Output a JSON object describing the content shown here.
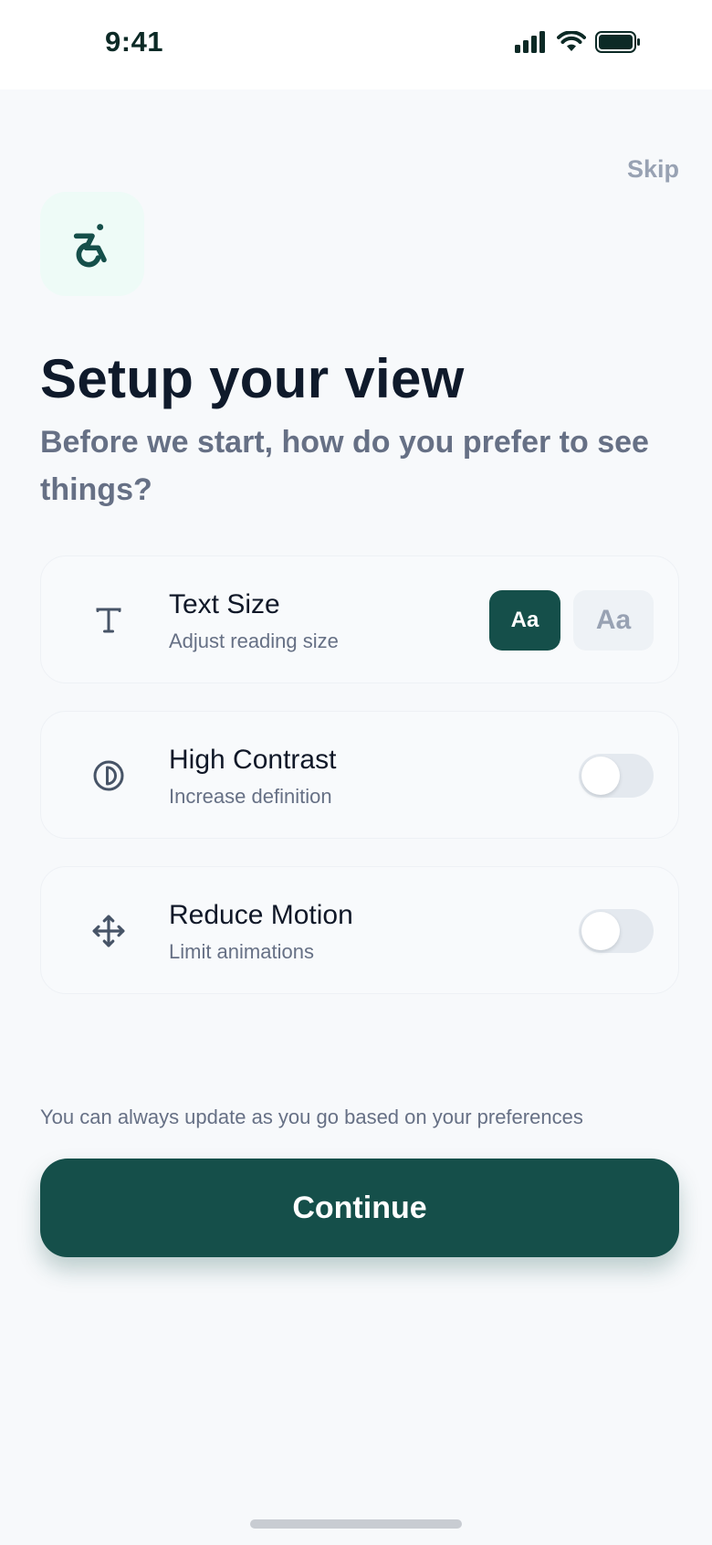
{
  "status_bar": {
    "time": "9:41"
  },
  "header": {
    "skip_label": "Skip"
  },
  "hero": {
    "icon": "accessibility-icon"
  },
  "title": "Setup your view",
  "subtitle": "Before we start, how do you prefer to see things?",
  "settings": [
    {
      "title": "Text Size",
      "subtitle": "Adjust reading size",
      "icon": "text-size-icon",
      "options": [
        {
          "label": "Aa",
          "selected": true
        },
        {
          "label": "Aa",
          "selected": false
        }
      ]
    },
    {
      "title": "High Contrast",
      "subtitle": "Increase definition",
      "icon": "contrast-icon",
      "enabled": false
    },
    {
      "title": "Reduce Motion",
      "subtitle": "Limit animations",
      "icon": "move-icon",
      "enabled": false
    }
  ],
  "footnote": "You can always update as you go based on your preferences",
  "continue_label": "Continue",
  "colors": {
    "primary": "#154f4a",
    "background": "#f7f9fb",
    "muted": "#667085"
  }
}
